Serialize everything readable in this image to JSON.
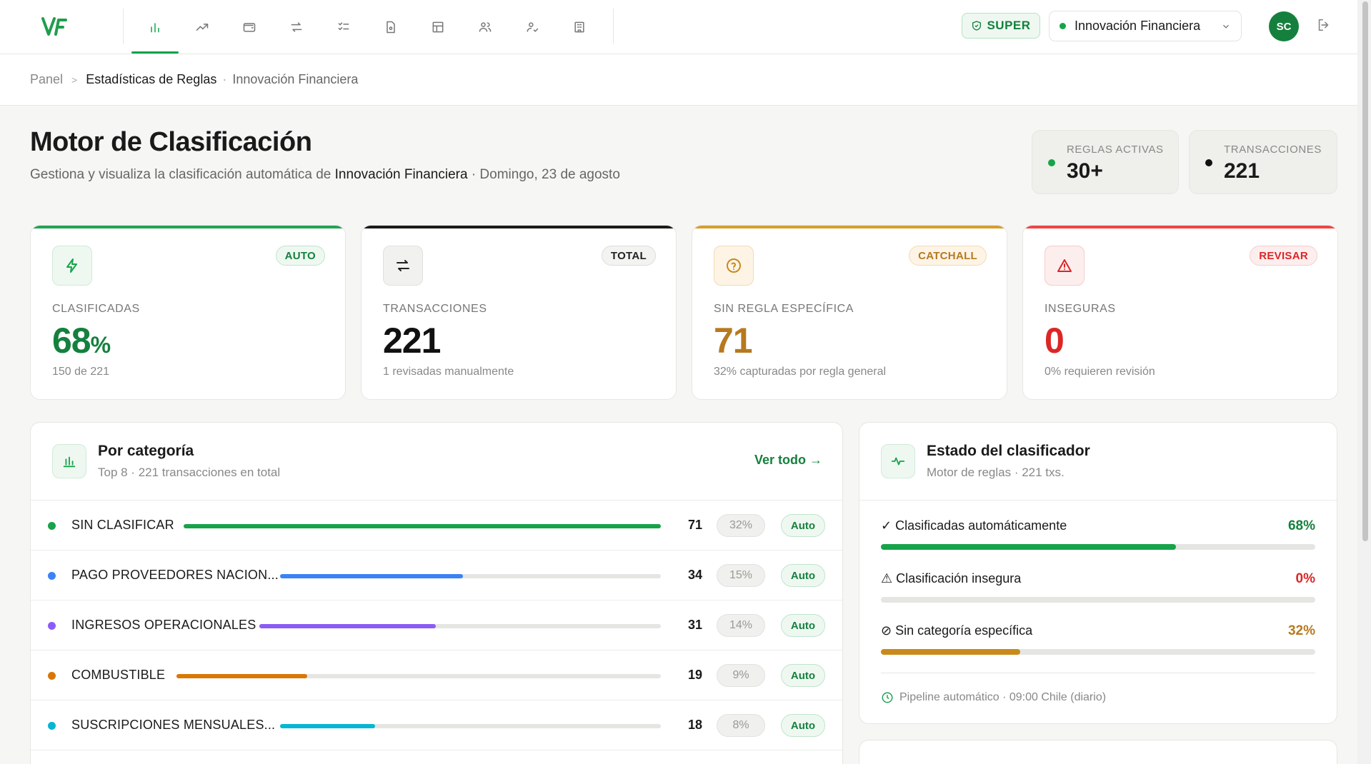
{
  "header": {
    "role_badge": "SUPER",
    "org_name": "Innovación Financiera",
    "avatar_initials": "SC",
    "accent_color": "#16a34a"
  },
  "nav": {
    "icons": [
      "bar-chart-icon",
      "trending-up-icon",
      "wallet-icon",
      "transfer-icon",
      "checklist-icon",
      "document-icon",
      "table-icon",
      "users-icon",
      "user-check-icon",
      "building-icon"
    ],
    "active_index": 0
  },
  "breadcrumb": {
    "root": "Panel",
    "current": "Estadísticas de Reglas",
    "org": "Innovación Financiera"
  },
  "page": {
    "title": "Motor de Clasificación",
    "subtitle_prefix": "Gestiona y visualiza la clasificación automática de ",
    "subtitle_org": "Innovación Financiera",
    "subtitle_suffix": " · Domingo, 23 de agosto"
  },
  "summary": {
    "active_rules_label": "REGLAS ACTIVAS",
    "active_rules_value": "30+",
    "transactions_label": "TRANSACCIONES",
    "transactions_value": "221"
  },
  "kpis": [
    {
      "badge": "AUTO",
      "label": "CLASIFICADAS",
      "value": "68",
      "unit": "%",
      "foot": "150 de 221",
      "color": "#15803d",
      "line_color": "#22a354"
    },
    {
      "badge": "TOTAL",
      "label": "TRANSACCIONES",
      "value": "221",
      "unit": "",
      "foot": "1 revisadas manualmente",
      "color": "#111111",
      "line_color": "#1a1a1a"
    },
    {
      "badge": "CATCHALL",
      "label": "SIN REGLA ESPECÍFICA",
      "value": "71",
      "unit": "",
      "foot": "32% capturadas por regla general",
      "color": "#b7791f",
      "line_color": "#d69e2e"
    },
    {
      "badge": "REVISAR",
      "label": "INSEGURAS",
      "value": "0",
      "unit": "",
      "foot": "0% requieren revisión",
      "color": "#dc2626",
      "line_color": "#ef4444"
    }
  ],
  "categories": {
    "title": "Por categoría",
    "subtitle": "Top 8 · 221 transacciones en total",
    "link": "Ver todo →",
    "rows": [
      {
        "name": "SIN CLASIFICAR",
        "count": "71",
        "pct": "32%",
        "tag": "Auto",
        "fill": 1.0,
        "color": "#16a34a"
      },
      {
        "name": "PAGO PROVEEDORES NACION...",
        "count": "34",
        "pct": "15%",
        "tag": "Auto",
        "fill": 0.48,
        "color": "#3b82f6"
      },
      {
        "name": "INGRESOS OPERACIONALES",
        "count": "31",
        "pct": "14%",
        "tag": "Auto",
        "fill": 0.44,
        "color": "#8b5cf6"
      },
      {
        "name": "COMBUSTIBLE",
        "count": "19",
        "pct": "9%",
        "tag": "Auto",
        "fill": 0.27,
        "color": "#d97706"
      },
      {
        "name": "SUSCRIPCIONES MENSUALES...",
        "count": "18",
        "pct": "8%",
        "tag": "Auto",
        "fill": 0.25,
        "color": "#06b6d4"
      }
    ]
  },
  "status": {
    "title": "Estado del clasificador",
    "subtitle": "Motor de reglas · 221 txs.",
    "rows": [
      {
        "label": "✓ Clasificadas automáticamente",
        "value": "68%",
        "fill": 0.68,
        "color": "#15803d",
        "bar": "#16a34a"
      },
      {
        "label": "⚠ Clasificación insegura",
        "value": "0%",
        "fill": 0.0,
        "color": "#dc2626",
        "bar": "#dc2626"
      },
      {
        "label": "⊘ Sin categoría específica",
        "value": "32%",
        "fill": 0.32,
        "color": "#b7791f",
        "bar": "#c98a1b"
      }
    ],
    "pipeline": "Pipeline automático · 09:00 Chile (diario)"
  }
}
